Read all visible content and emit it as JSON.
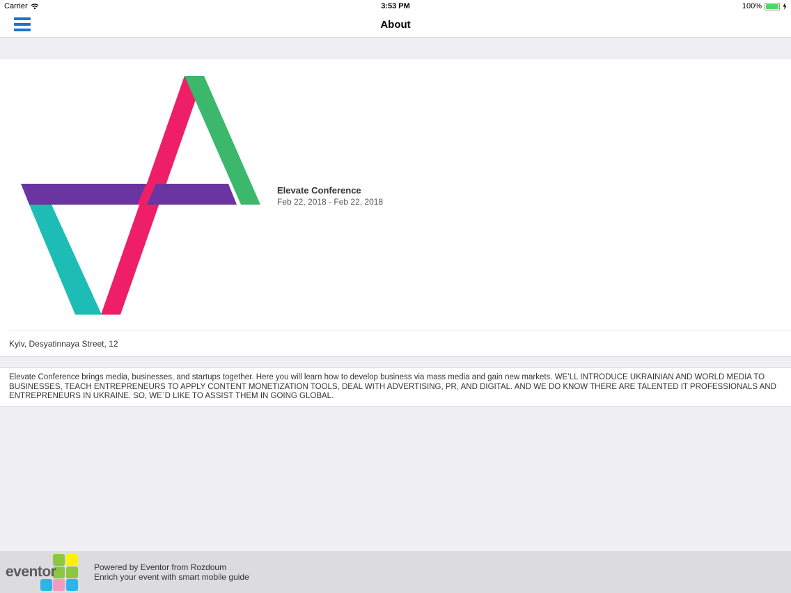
{
  "status_bar": {
    "carrier": "Carrier",
    "time": "3:53 PM",
    "battery": "100%"
  },
  "nav": {
    "title": "About",
    "menu_icon": "hamburger-menu-icon"
  },
  "event": {
    "name": "Elevate Conference",
    "dates": "Feb 22, 2018 - Feb 22, 2018",
    "address": "Kyiv, Desyatinnaya Street, 12",
    "description": "Elevate Conference brings media, businesses, and startups together. Here you will learn how to develop business via mass media and gain new markets. WE’LL INTRODUCE UKRAINIAN AND WORLD MEDIA TO BUSINESSES, TEACH ENTREPRENEURS TO APPLY CONTENT MONETIZATION TOOLS, DEAL WITH ADVERTISING, PR, AND DIGITAL. AND WE DO KNOW THERE ARE TALENTED IT PROFESSIONALS AND ENTREPRENEURS IN UKRAINE. SO, WE`D LIKE TO ASSIST THEM IN GOING GLOBAL.",
    "logo_colors": {
      "pink": "#ee1f66",
      "green": "#3bb86b",
      "purple": "#6a35a0",
      "teal": "#1dbdb5"
    }
  },
  "footer": {
    "brand": "eventor",
    "line1": "Powered by Eventor from Rozdoum",
    "line2": "Enrich your event with smart mobile guide"
  },
  "colors": {
    "accent": "#1a73c9",
    "background": "#efeff4"
  }
}
